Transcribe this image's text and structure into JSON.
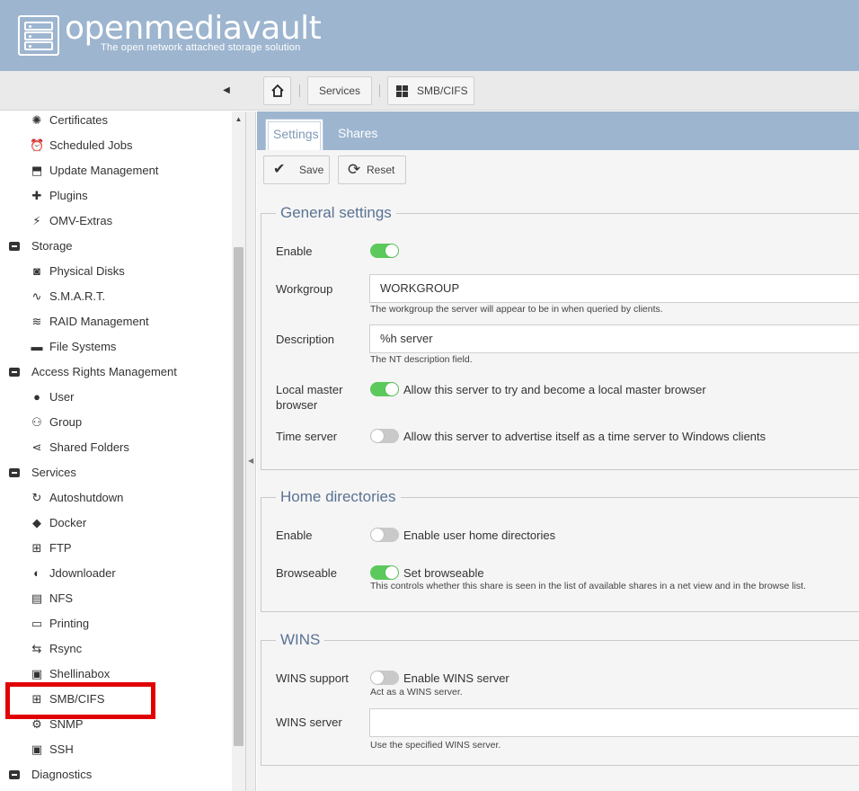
{
  "header": {
    "app_name": "openmediavault",
    "tagline": "The open network attached storage solution",
    "logo_icon": "server-rack-icon"
  },
  "breadcrumb": {
    "home_icon": "home-icon",
    "items": [
      "Services",
      "SMB/CIFS"
    ]
  },
  "sidebar": {
    "items": [
      {
        "label": "Certificates",
        "icon": "certificate-icon",
        "type": "child"
      },
      {
        "label": "Scheduled Jobs",
        "icon": "alarm-clock-icon",
        "type": "child"
      },
      {
        "label": "Update Management",
        "icon": "update-icon",
        "type": "child"
      },
      {
        "label": "Plugins",
        "icon": "puzzle-icon",
        "type": "child"
      },
      {
        "label": "OMV-Extras",
        "icon": "plug-icon",
        "type": "child"
      },
      {
        "label": "Storage",
        "icon": "collapse-icon",
        "type": "group"
      },
      {
        "label": "Physical Disks",
        "icon": "disk-icon",
        "type": "child"
      },
      {
        "label": "S.M.A.R.T.",
        "icon": "heartbeat-icon",
        "type": "child"
      },
      {
        "label": "RAID Management",
        "icon": "database-icon",
        "type": "child"
      },
      {
        "label": "File Systems",
        "icon": "folder-icon",
        "type": "child"
      },
      {
        "label": "Access Rights Management",
        "icon": "collapse-icon",
        "type": "group"
      },
      {
        "label": "User",
        "icon": "user-icon",
        "type": "child"
      },
      {
        "label": "Group",
        "icon": "users-icon",
        "type": "child"
      },
      {
        "label": "Shared Folders",
        "icon": "share-icon",
        "type": "child"
      },
      {
        "label": "Services",
        "icon": "collapse-icon",
        "type": "group"
      },
      {
        "label": "Autoshutdown",
        "icon": "power-icon",
        "type": "child"
      },
      {
        "label": "Docker",
        "icon": "docker-icon",
        "type": "child"
      },
      {
        "label": "FTP",
        "icon": "network-icon",
        "type": "child"
      },
      {
        "label": "Jdownloader",
        "icon": "download-icon",
        "type": "child"
      },
      {
        "label": "NFS",
        "icon": "file-icon",
        "type": "child"
      },
      {
        "label": "Printing",
        "icon": "printer-icon",
        "type": "child"
      },
      {
        "label": "Rsync",
        "icon": "sync-icon",
        "type": "child"
      },
      {
        "label": "Shellinabox",
        "icon": "terminal-icon",
        "type": "child"
      },
      {
        "label": "SMB/CIFS",
        "icon": "windows-icon",
        "type": "child"
      },
      {
        "label": "SNMP",
        "icon": "snmp-icon",
        "type": "child"
      },
      {
        "label": "SSH",
        "icon": "terminal-icon",
        "type": "child"
      },
      {
        "label": "Diagnostics",
        "icon": "collapse-icon",
        "type": "group"
      }
    ]
  },
  "tabs": {
    "settings": "Settings",
    "shares": "Shares"
  },
  "actions": {
    "save": "Save",
    "reset": "Reset"
  },
  "general": {
    "legend": "General settings",
    "enable_label": "Enable",
    "enable_on": true,
    "workgroup_label": "Workgroup",
    "workgroup_value": "WORKGROUP",
    "workgroup_hint": "The workgroup the server will appear to be in when queried by clients.",
    "description_label": "Description",
    "description_value": "%h server",
    "description_hint": "The NT description field.",
    "local_master_label_1": "Local master",
    "local_master_label_2": "browser",
    "local_master_on": true,
    "local_master_text": "Allow this server to try and become a local master browser",
    "time_server_label": "Time server",
    "time_server_on": false,
    "time_server_text": "Allow this server to advertise itself as a time server to Windows clients"
  },
  "home": {
    "legend": "Home directories",
    "enable_label": "Enable",
    "enable_on": false,
    "enable_text": "Enable user home directories",
    "browseable_label": "Browseable",
    "browseable_on": true,
    "browseable_text": "Set browseable",
    "browseable_hint": "This controls whether this share is seen in the list of available shares in a net view and in the browse list."
  },
  "wins": {
    "legend": "WINS",
    "support_label": "WINS support",
    "support_on": false,
    "support_text": "Enable WINS server",
    "support_hint": "Act as a WINS server.",
    "server_label": "WINS server",
    "server_value": "",
    "server_hint": "Use the specified WINS server."
  },
  "colors": {
    "header_bg": "#9db5cf",
    "toggle_on": "#5cc95c",
    "toggle_off": "#c9c9c9",
    "legend_text": "#5a7293",
    "highlight_box": "#e00000"
  }
}
